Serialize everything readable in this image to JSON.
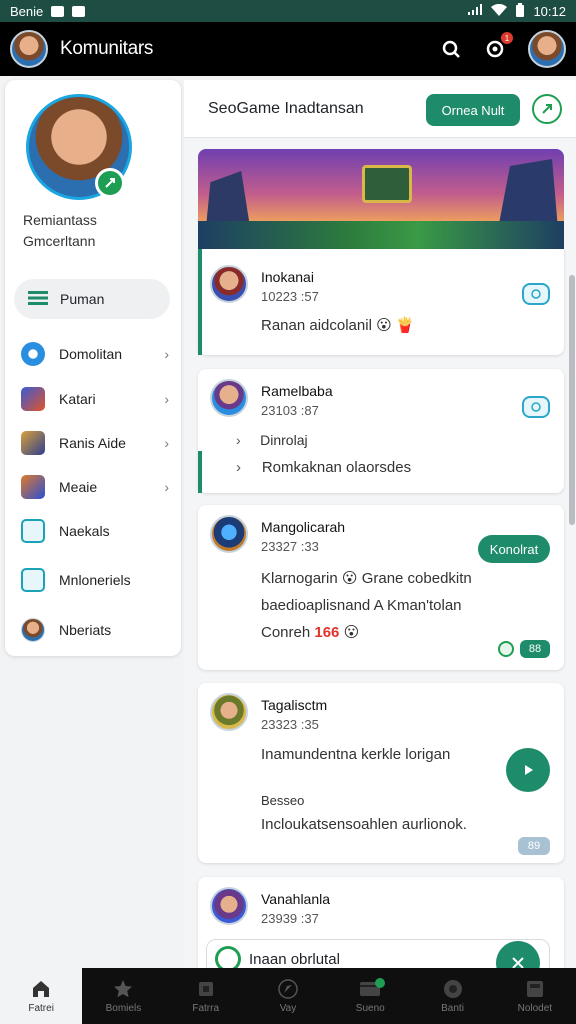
{
  "status_bar": {
    "carrier": "Benie",
    "time": "10:12"
  },
  "app_bar": {
    "title": "Komunitars"
  },
  "sidebar": {
    "profile_name": "Remiantass",
    "profile_sub": "Gmcerltann",
    "active_item": "Puman",
    "items": [
      {
        "label": "Domolitan",
        "icon": "swirl-icon",
        "chevron": true
      },
      {
        "label": "Katari",
        "icon": "game-icon",
        "chevron": true
      },
      {
        "label": "Ranis Aide",
        "icon": "hero-icon",
        "chevron": true
      },
      {
        "label": "Meaie",
        "icon": "arena-icon",
        "chevron": true
      },
      {
        "label": "Naekals",
        "icon": "chat-icon",
        "chevron": false
      },
      {
        "label": "Mnloneriels",
        "icon": "image-icon",
        "chevron": false
      },
      {
        "label": "Nberiats",
        "icon": "avatar-icon",
        "chevron": false
      }
    ]
  },
  "main": {
    "header_title": "SeoGame Inadtansan",
    "header_button": "Ornea Nult",
    "posts": [
      {
        "name": "Inokanai",
        "time": "10223 :57",
        "text": "Ranan aidcolanil"
      },
      {
        "name": "Ramelbaba",
        "time": "23103 :87",
        "line1": "Dinrolaj",
        "line2": "Romkaknan olaorsdes"
      },
      {
        "name": "Mangolicarah",
        "time": "23327 :33",
        "button": "Konolrat",
        "line1": "Klarnogarin",
        "line1b": "Grane cobedkitn",
        "line2": "baedioaplisnand A Kman'tolan",
        "line3": "Conreh",
        "line3_highlight": "166",
        "chip": "88"
      },
      {
        "name": "Tagalisctm",
        "time": "23323 :35",
        "line1": "Inamundentna kerkle lorigan",
        "line2": "Besseo",
        "line3": "Incloukatsensoahlen aurlionok.",
        "chip": "89"
      },
      {
        "name": "Vanahlanla",
        "time": "23939 :37",
        "reply": "Inaan obrlutal"
      }
    ]
  },
  "bottom_nav": [
    {
      "label": "Fatrei",
      "icon": "home-icon",
      "active": true
    },
    {
      "label": "Bomiels",
      "icon": "star-icon",
      "active": false
    },
    {
      "label": "Fatrra",
      "icon": "folder-icon",
      "active": false
    },
    {
      "label": "Vay",
      "icon": "compass-icon",
      "active": false
    },
    {
      "label": "Sueno",
      "icon": "inbox-icon",
      "active": false
    },
    {
      "label": "Banti",
      "icon": "record-icon",
      "active": false
    },
    {
      "label": "Nolodet",
      "icon": "profile-icon",
      "active": false
    }
  ],
  "colors": {
    "accent": "#1e8c6a",
    "topbar": "#000000",
    "status": "#1e4d44"
  }
}
